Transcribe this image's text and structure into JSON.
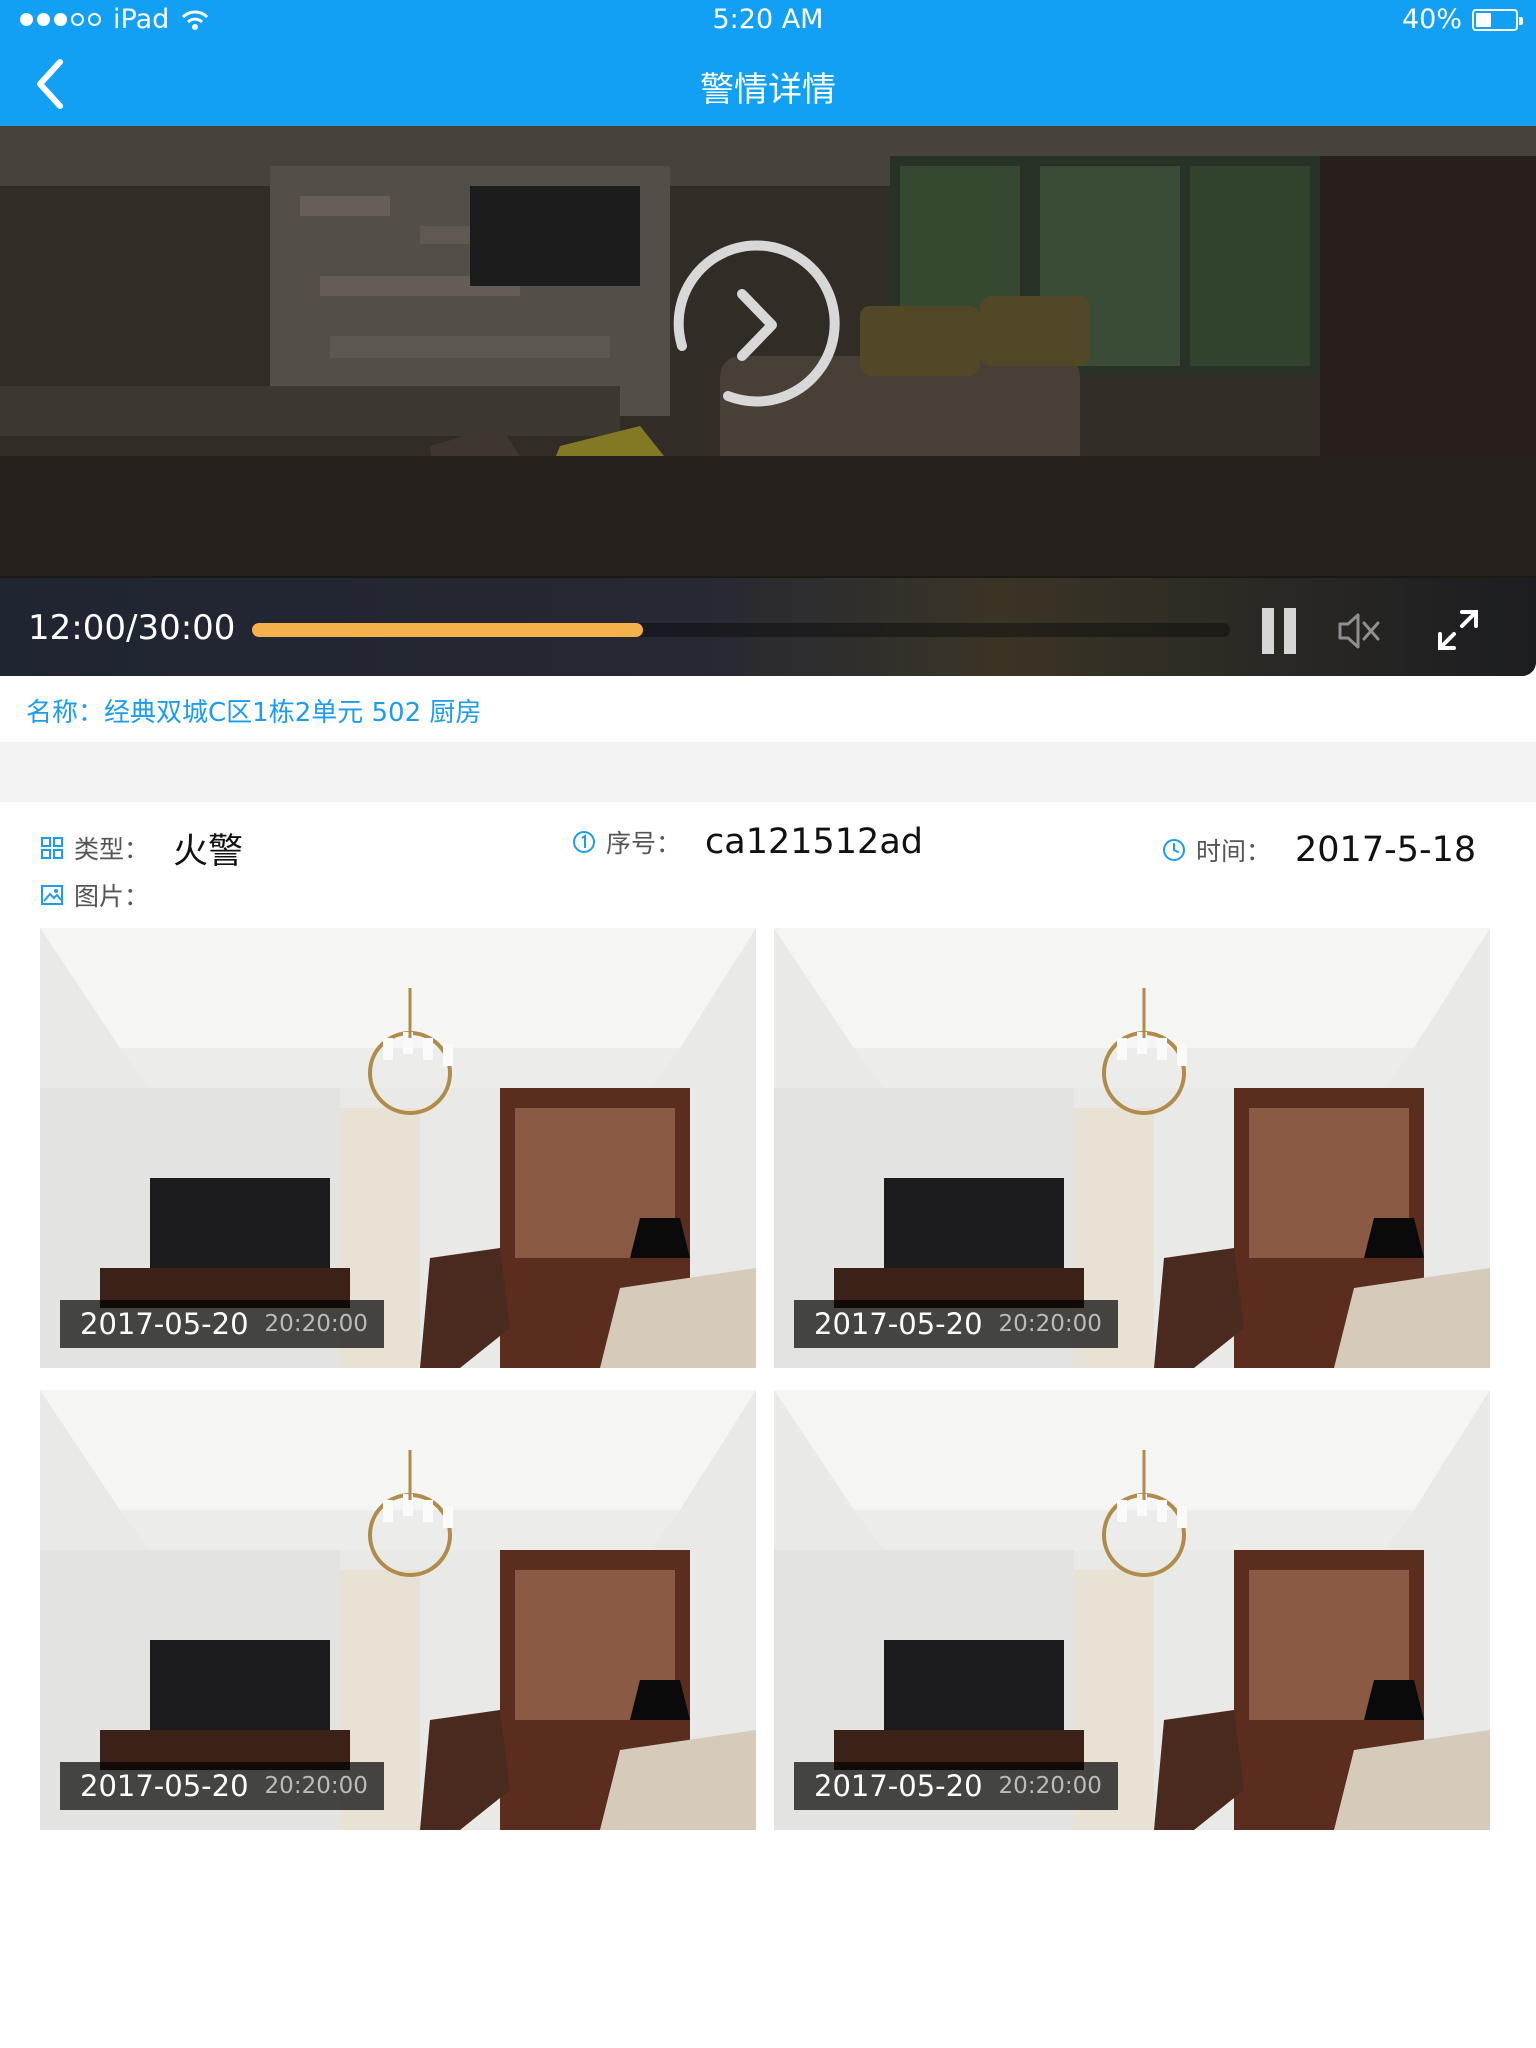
{
  "status_bar": {
    "carrier": "iPad",
    "time": "5:20 AM",
    "battery": "40%",
    "battery_level": 0.4
  },
  "nav": {
    "title": "警情详情",
    "back_icon": "chevron-left-icon"
  },
  "player": {
    "time_display": "12:00/30:00",
    "progress": 0.4,
    "icons": [
      "play-circle-icon",
      "pause-icon",
      "mute-icon",
      "fullscreen-icon"
    ]
  },
  "name_line": "名称：经典双城C区1栋2单元 502 厨房",
  "info": {
    "type_label": "类型：",
    "type_value": "火警",
    "serial_label": "序号：",
    "serial_value": "ca121512ad",
    "time_label": "时间：",
    "time_value": "2017-5-18",
    "pictures_label": "图片："
  },
  "photos": [
    {
      "date": "2017-05-20",
      "time": "20:20:00"
    },
    {
      "date": "2017-05-20",
      "time": "20:20:00"
    },
    {
      "date": "2017-05-20",
      "time": "20:20:00"
    },
    {
      "date": "2017-05-20",
      "time": "20:20:00"
    }
  ],
  "colors": {
    "primary": "#12a0f5",
    "progress": "#f6b24a",
    "link": "#1b9cf0"
  }
}
